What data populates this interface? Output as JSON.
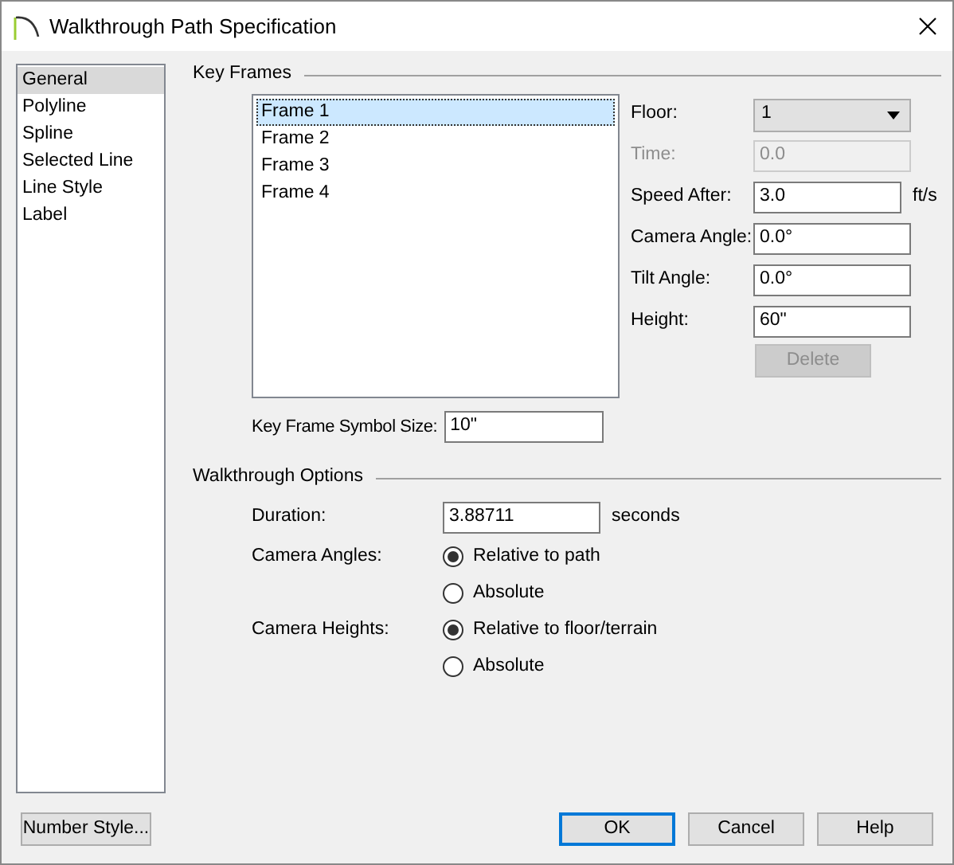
{
  "window": {
    "title": "Walkthrough Path Specification"
  },
  "sidebar": {
    "items": [
      {
        "label": "General",
        "selected": true
      },
      {
        "label": "Polyline",
        "selected": false
      },
      {
        "label": "Spline",
        "selected": false
      },
      {
        "label": "Selected Line",
        "selected": false
      },
      {
        "label": "Line Style",
        "selected": false
      },
      {
        "label": "Label",
        "selected": false
      }
    ]
  },
  "key_frames": {
    "title": "Key Frames",
    "frames": [
      {
        "label": "Frame 1",
        "selected": true
      },
      {
        "label": "Frame 2",
        "selected": false
      },
      {
        "label": "Frame 3",
        "selected": false
      },
      {
        "label": "Frame 4",
        "selected": false
      }
    ],
    "fields": [
      {
        "kind": "dropdown",
        "label": "Floor:",
        "value": "1",
        "disabled": false
      },
      {
        "kind": "text",
        "label": "Time:",
        "value": "0.0",
        "disabled": true
      },
      {
        "kind": "text",
        "label": "Speed After:",
        "value": "3.0",
        "disabled": false,
        "unit": "ft/s"
      },
      {
        "kind": "text",
        "label": "Camera Angle:",
        "value": "0.0°",
        "disabled": false
      },
      {
        "kind": "text",
        "label": "Tilt Angle:",
        "value": "0.0°",
        "disabled": false
      },
      {
        "kind": "text",
        "label": "Height:",
        "value": "60\"",
        "disabled": false
      }
    ],
    "delete_button": {
      "label": "Delete",
      "disabled": true
    },
    "symbol_size": {
      "label": "Key Frame Symbol Size:",
      "value": "10\""
    }
  },
  "walkthrough_options": {
    "title": "Walkthrough Options",
    "duration": {
      "label": "Duration:",
      "value": "3.88711",
      "unit": "seconds"
    },
    "groups": [
      {
        "label": "Camera Angles:",
        "options": [
          {
            "label": "Relative to path",
            "selected": true
          },
          {
            "label": "Absolute",
            "selected": false
          }
        ]
      },
      {
        "label": "Camera Heights:",
        "options": [
          {
            "label": "Relative to floor/terrain",
            "selected": true
          },
          {
            "label": "Absolute",
            "selected": false
          }
        ]
      }
    ]
  },
  "number_style_button": "Number Style...",
  "buttons": [
    {
      "label": "OK",
      "default": true
    },
    {
      "label": "Cancel",
      "default": false
    },
    {
      "label": "Help",
      "default": false
    }
  ]
}
